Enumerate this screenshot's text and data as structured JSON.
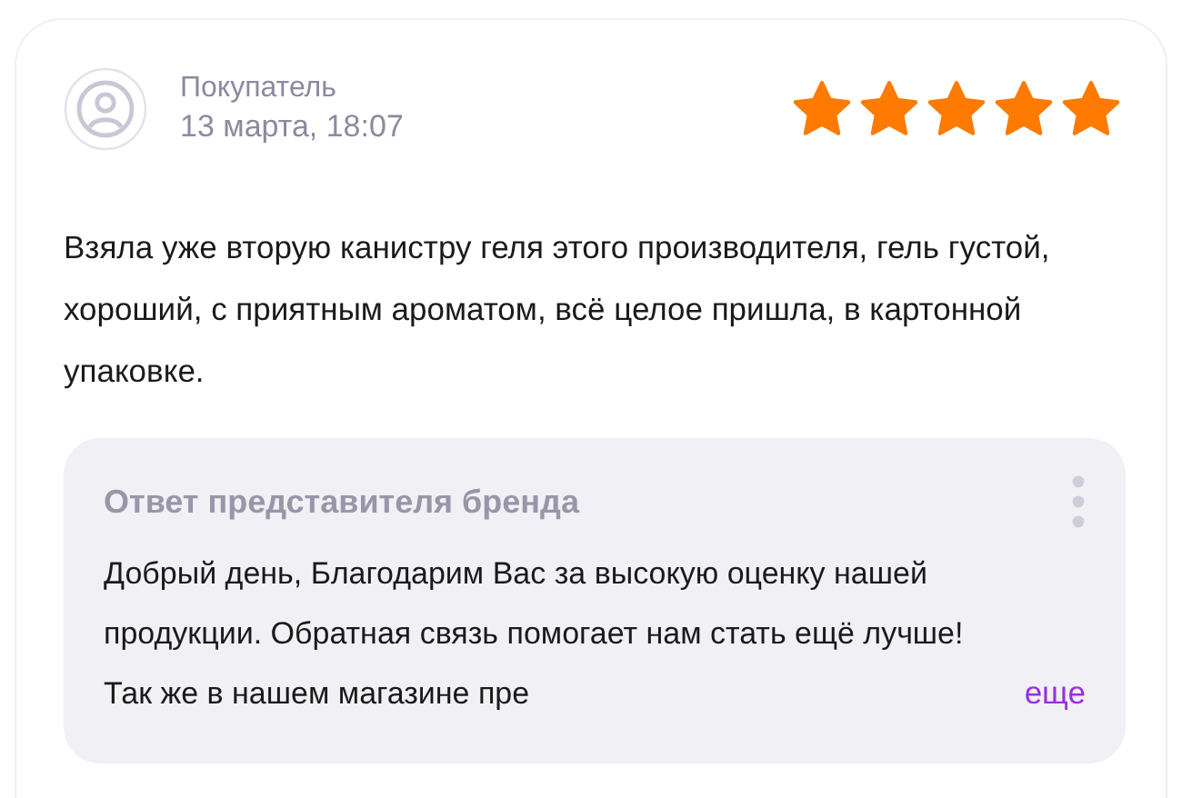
{
  "review": {
    "author": "Покупатель",
    "date": "13 марта, 18:07",
    "stars": 5,
    "text": "Взяла уже вторую канистру геля этого производителя, гель густой, хороший, с приятным ароматом, всё целое пришла, в картонной упаковке."
  },
  "brand_reply": {
    "title": "Ответ представителя бренда",
    "text": "Добрый день, Благодарим Вас за высокую оценку нашей продукции. Обратная связь помогает нам стать ещё лучше! Так же в нашем магазине пре",
    "more_link": "еще"
  }
}
